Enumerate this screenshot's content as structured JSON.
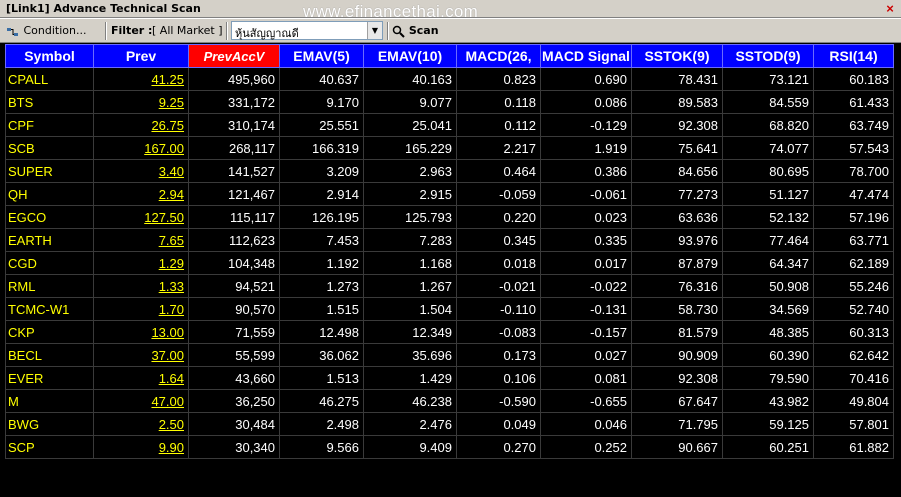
{
  "window": {
    "title": "[Link1] Advance Technical Scan",
    "close_glyph": "×"
  },
  "watermark": "www.efinancethai.com",
  "toolbar": {
    "condition_label": "Condition...",
    "filter_label": "Filter :",
    "filter_value": "[ All Market ]",
    "combo_value": "หุ้นสัญญาณดี",
    "scan_label": "Scan"
  },
  "table": {
    "headers": [
      "Symbol",
      "Prev",
      "PrevAccV",
      "EMAV(5)",
      "EMAV(10)",
      "MACD(26,",
      "MACD Signal",
      "SSTOK(9)",
      "SSTOD(9)",
      "RSI(14)"
    ],
    "rows": [
      [
        "CPALL",
        "41.25",
        "495,960",
        "40.637",
        "40.163",
        "0.823",
        "0.690",
        "78.431",
        "73.121",
        "60.183"
      ],
      [
        "BTS",
        "9.25",
        "331,172",
        "9.170",
        "9.077",
        "0.118",
        "0.086",
        "89.583",
        "84.559",
        "61.433"
      ],
      [
        "CPF",
        "26.75",
        "310,174",
        "25.551",
        "25.041",
        "0.112",
        "-0.129",
        "92.308",
        "68.820",
        "63.749"
      ],
      [
        "SCB",
        "167.00",
        "268,117",
        "166.319",
        "165.229",
        "2.217",
        "1.919",
        "75.641",
        "74.077",
        "57.543"
      ],
      [
        "SUPER",
        "3.40",
        "141,527",
        "3.209",
        "2.963",
        "0.464",
        "0.386",
        "84.656",
        "80.695",
        "78.700"
      ],
      [
        "QH",
        "2.94",
        "121,467",
        "2.914",
        "2.915",
        "-0.059",
        "-0.061",
        "77.273",
        "51.127",
        "47.474"
      ],
      [
        "EGCO",
        "127.50",
        "115,117",
        "126.195",
        "125.793",
        "0.220",
        "0.023",
        "63.636",
        "52.132",
        "57.196"
      ],
      [
        "EARTH",
        "7.65",
        "112,623",
        "7.453",
        "7.283",
        "0.345",
        "0.335",
        "93.976",
        "77.464",
        "63.771"
      ],
      [
        "CGD",
        "1.29",
        "104,348",
        "1.192",
        "1.168",
        "0.018",
        "0.017",
        "87.879",
        "64.347",
        "62.189"
      ],
      [
        "RML",
        "1.33",
        "94,521",
        "1.273",
        "1.267",
        "-0.021",
        "-0.022",
        "76.316",
        "50.908",
        "55.246"
      ],
      [
        "TCMC-W1",
        "1.70",
        "90,570",
        "1.515",
        "1.504",
        "-0.110",
        "-0.131",
        "58.730",
        "34.569",
        "52.740"
      ],
      [
        "CKP",
        "13.00",
        "71,559",
        "12.498",
        "12.349",
        "-0.083",
        "-0.157",
        "81.579",
        "48.385",
        "60.313"
      ],
      [
        "BECL",
        "37.00",
        "55,599",
        "36.062",
        "35.696",
        "0.173",
        "0.027",
        "90.909",
        "60.390",
        "62.642"
      ],
      [
        "EVER",
        "1.64",
        "43,660",
        "1.513",
        "1.429",
        "0.106",
        "0.081",
        "92.308",
        "79.590",
        "70.416"
      ],
      [
        "M",
        "47.00",
        "36,250",
        "46.275",
        "46.238",
        "-0.590",
        "-0.655",
        "67.647",
        "43.982",
        "49.804"
      ],
      [
        "BWG",
        "2.50",
        "30,484",
        "2.498",
        "2.476",
        "0.049",
        "0.046",
        "71.795",
        "59.125",
        "57.801"
      ],
      [
        "SCP",
        "9.90",
        "30,340",
        "9.566",
        "9.409",
        "0.270",
        "0.252",
        "90.667",
        "60.251",
        "61.882"
      ]
    ]
  },
  "colors": {
    "header_bg": "#0000ff",
    "header_sorted_bg": "#ff0000",
    "symbol_text": "#ffff00",
    "value_text": "#ffffff",
    "grid_bg": "#000000"
  }
}
